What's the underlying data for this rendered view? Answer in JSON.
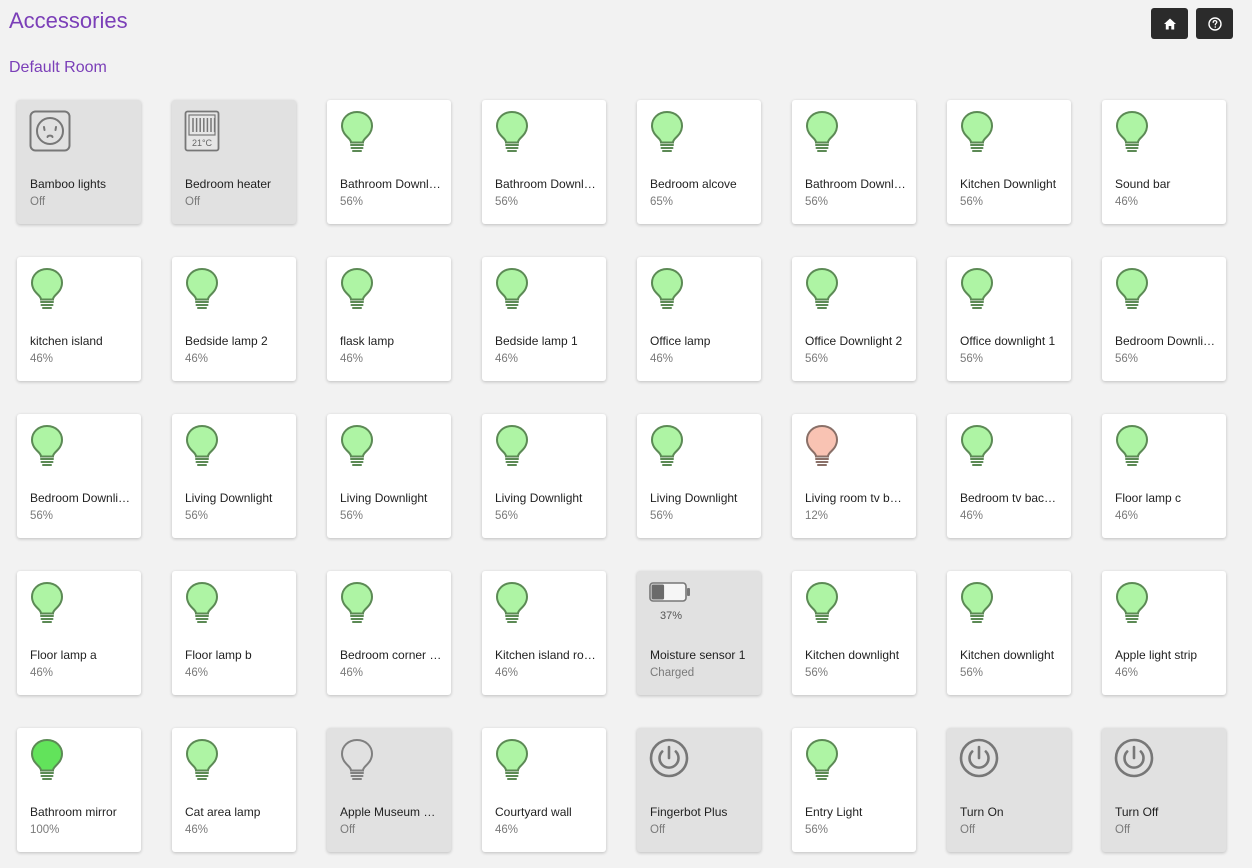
{
  "page": {
    "title": "Accessories",
    "room_title": "Default Room"
  },
  "colors": {
    "accent": "#7b3fb8",
    "bulb_on": "#aef4a4",
    "bulb_full": "#62e35b",
    "bulb_warm": "#f9c3b3",
    "bulb_stroke": "#5c8a55",
    "tile_on": "#ffffff",
    "tile_off": "#e1e1e1"
  },
  "header_buttons": [
    {
      "icon": "home-icon"
    },
    {
      "icon": "help-icon"
    }
  ],
  "accessories": [
    {
      "name": "Bamboo lights",
      "status": "Off",
      "icon": "outlet",
      "on": false
    },
    {
      "name": "Bedroom heater",
      "status": "Off",
      "icon": "heater",
      "on": false,
      "icon_text": "21°C"
    },
    {
      "name": "Bathroom Downlight",
      "status": "56%",
      "icon": "bulb",
      "on": true
    },
    {
      "name": "Bathroom Downlight",
      "status": "56%",
      "icon": "bulb",
      "on": true
    },
    {
      "name": "Bedroom alcove",
      "status": "65%",
      "icon": "bulb",
      "on": true
    },
    {
      "name": "Bathroom Downlight",
      "status": "56%",
      "icon": "bulb",
      "on": true
    },
    {
      "name": "Kitchen Downlight",
      "status": "56%",
      "icon": "bulb",
      "on": true
    },
    {
      "name": "Sound bar",
      "status": "46%",
      "icon": "bulb",
      "on": true
    },
    {
      "name": "kitchen island",
      "status": "46%",
      "icon": "bulb",
      "on": true
    },
    {
      "name": "Bedside lamp 2",
      "status": "46%",
      "icon": "bulb",
      "on": true
    },
    {
      "name": "flask lamp",
      "status": "46%",
      "icon": "bulb",
      "on": true
    },
    {
      "name": "Bedside lamp 1",
      "status": "46%",
      "icon": "bulb",
      "on": true
    },
    {
      "name": "Office lamp",
      "status": "46%",
      "icon": "bulb",
      "on": true
    },
    {
      "name": "Office Downlight 2",
      "status": "56%",
      "icon": "bulb",
      "on": true
    },
    {
      "name": "Office downlight 1",
      "status": "56%",
      "icon": "bulb",
      "on": true
    },
    {
      "name": "Bedroom Downlight",
      "status": "56%",
      "icon": "bulb",
      "on": true
    },
    {
      "name": "Bedroom Downlight",
      "status": "56%",
      "icon": "bulb",
      "on": true
    },
    {
      "name": "Living Downlight",
      "status": "56%",
      "icon": "bulb",
      "on": true
    },
    {
      "name": "Living Downlight",
      "status": "56%",
      "icon": "bulb",
      "on": true
    },
    {
      "name": "Living Downlight",
      "status": "56%",
      "icon": "bulb",
      "on": true
    },
    {
      "name": "Living Downlight",
      "status": "56%",
      "icon": "bulb",
      "on": true
    },
    {
      "name": "Living room tv backlight",
      "status": "12%",
      "icon": "bulb",
      "on": true,
      "tint": "warm"
    },
    {
      "name": "Bedroom tv backlight",
      "status": "46%",
      "icon": "bulb",
      "on": true
    },
    {
      "name": "Floor lamp c",
      "status": "46%",
      "icon": "bulb",
      "on": true
    },
    {
      "name": "Floor lamp a",
      "status": "46%",
      "icon": "bulb",
      "on": true
    },
    {
      "name": "Floor lamp b",
      "status": "46%",
      "icon": "bulb",
      "on": true
    },
    {
      "name": "Bedroom corner lamp",
      "status": "46%",
      "icon": "bulb",
      "on": true
    },
    {
      "name": "Kitchen island room",
      "status": "46%",
      "icon": "bulb",
      "on": true
    },
    {
      "name": "Moisture sensor 1",
      "status": "Charged",
      "icon": "battery",
      "on": false,
      "battery_level": 0.37,
      "icon_text": "37%"
    },
    {
      "name": "Kitchen downlight",
      "status": "56%",
      "icon": "bulb",
      "on": true
    },
    {
      "name": "Kitchen downlight",
      "status": "56%",
      "icon": "bulb",
      "on": true
    },
    {
      "name": "Apple light strip",
      "status": "46%",
      "icon": "bulb",
      "on": true
    },
    {
      "name": "Bathroom mirror",
      "status": "100%",
      "icon": "bulb",
      "on": true,
      "tint": "full"
    },
    {
      "name": "Cat area lamp",
      "status": "46%",
      "icon": "bulb",
      "on": true
    },
    {
      "name": "Apple Museum Strip",
      "status": "Off",
      "icon": "bulb",
      "on": false
    },
    {
      "name": "Courtyard wall",
      "status": "46%",
      "icon": "bulb",
      "on": true
    },
    {
      "name": "Fingerbot Plus",
      "status": "Off",
      "icon": "power",
      "on": false
    },
    {
      "name": "Entry Light",
      "status": "56%",
      "icon": "bulb",
      "on": true
    },
    {
      "name": "Turn On",
      "status": "Off",
      "icon": "power",
      "on": false
    },
    {
      "name": "Turn Off",
      "status": "Off",
      "icon": "power",
      "on": false
    }
  ]
}
